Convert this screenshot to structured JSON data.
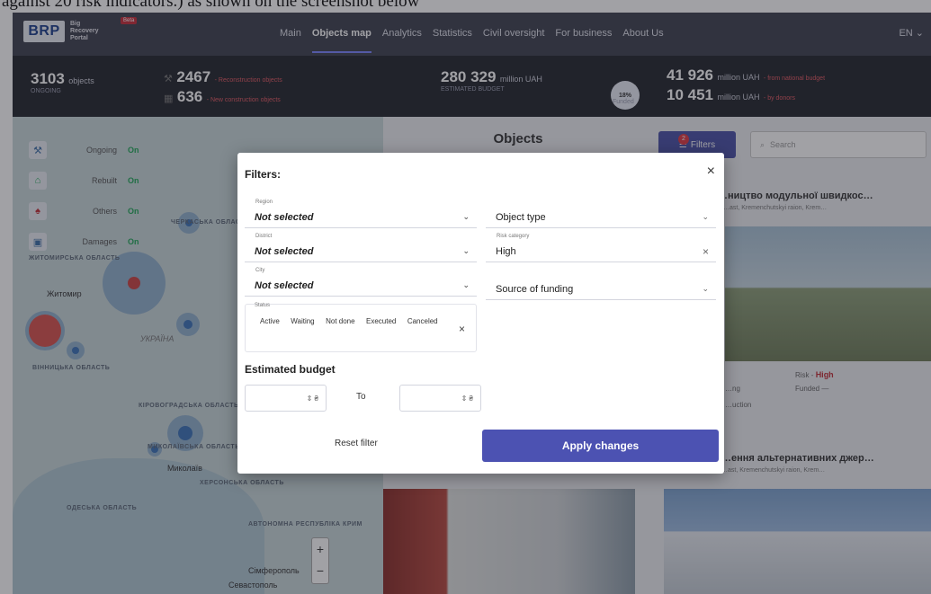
{
  "caption": "against 20 risk indicators.) as shown on the screenshot below",
  "header": {
    "logo_abbr": "BRP",
    "logo_line1": "Big",
    "logo_line2": "Recovery",
    "logo_line3": "Portal",
    "logo_badge": "Beta",
    "nav": [
      "Main",
      "Objects map",
      "Analytics",
      "Statistics",
      "Civil oversight",
      "For business",
      "About Us"
    ],
    "active_nav": "Objects map",
    "lang": "EN"
  },
  "stats": {
    "total_count": "3103",
    "total_unit": "objects",
    "total_status": "ONGOING",
    "reconstruction_count": "2467",
    "reconstruction_label": "- Reconstruction objects",
    "new_count": "636",
    "new_label": "- New construction objects",
    "budget_value": "280 329",
    "budget_unit": "million UAH",
    "budget_label": "ESTIMATED BUDGET",
    "funded_pct": "18%",
    "funded_label": "Funded",
    "state_value": "41 926",
    "state_unit": "million UAH",
    "state_label": "- from national budget",
    "donor_value": "10 451",
    "donor_unit": "million UAH",
    "donor_label": "- by donors"
  },
  "map": {
    "legend": [
      {
        "label": "Ongoing",
        "state": "On",
        "icon": "crane-icon"
      },
      {
        "label": "Rebuilt",
        "state": "On",
        "icon": "house-icon"
      },
      {
        "label": "Others",
        "state": "On",
        "icon": "tree-icon"
      },
      {
        "label": "Damages",
        "state": "On",
        "icon": "damaged-building-icon"
      }
    ],
    "regions": [
      "ЖИТОМИРСЬКА ОБЛАСТЬ",
      "ВІННИЦЬКА ОБЛАСТЬ",
      "КІРОВОГРАДСЬКА ОБЛАСТЬ",
      "МИКОЛАЇВСЬКА ОБЛАСТЬ",
      "ХЕРСОНСЬКА ОБЛАСТЬ",
      "ОДЕСЬКА ОБЛАСТЬ",
      "АВТОНОМНА РЕСПУБЛІКА КРИМ",
      "ЧЕРКАСЬКА ОБЛАСТЬ"
    ],
    "cities": [
      "Житомир",
      "УКРАЇНА",
      "Миколаїв",
      "Сімферополь",
      "Севастополь"
    ],
    "zoom_in": "+",
    "zoom_out": "−"
  },
  "content": {
    "title": "Objects",
    "filters_label": "Filters",
    "filters_count": "2",
    "search_placeholder": "Search",
    "card1_title": "…ництво модульної швидкос…",
    "card1_sub": "…ast, Kremenchutskyi raion, Krem…",
    "card1_risk_label": "Risk -",
    "card1_risk_value": "High",
    "card1_funded": "Funded —",
    "card1_status1": "…ng",
    "card1_status2": "…uction",
    "card2_title": "…ення альтернативних джер…",
    "card2_sub": "…ast, Kremenchutskyi raion, Krem…"
  },
  "modal": {
    "title": "Filters:",
    "region_label": "Region",
    "region_value": "Not selected",
    "object_type_placeholder": "Object type",
    "district_label": "District",
    "district_value": "Not selected",
    "risk_label": "Risk category",
    "risk_value": "High",
    "city_label": "City",
    "city_value": "Not selected",
    "funding_placeholder": "Source of funding",
    "status_label": "Status",
    "status_chips": [
      "Active",
      "Waiting",
      "Not done",
      "Executed",
      "Canceled"
    ],
    "budget_title": "Estimated budget",
    "currency": "₴",
    "to_label": "To",
    "reset_label": "Reset filter",
    "apply_label": "Apply changes"
  },
  "colors": {
    "nav_bg": "#3f4250",
    "stats_bg": "#24262e",
    "accent": "#4c52b2",
    "danger": "#c22d36",
    "on_green": "#23a85a"
  }
}
